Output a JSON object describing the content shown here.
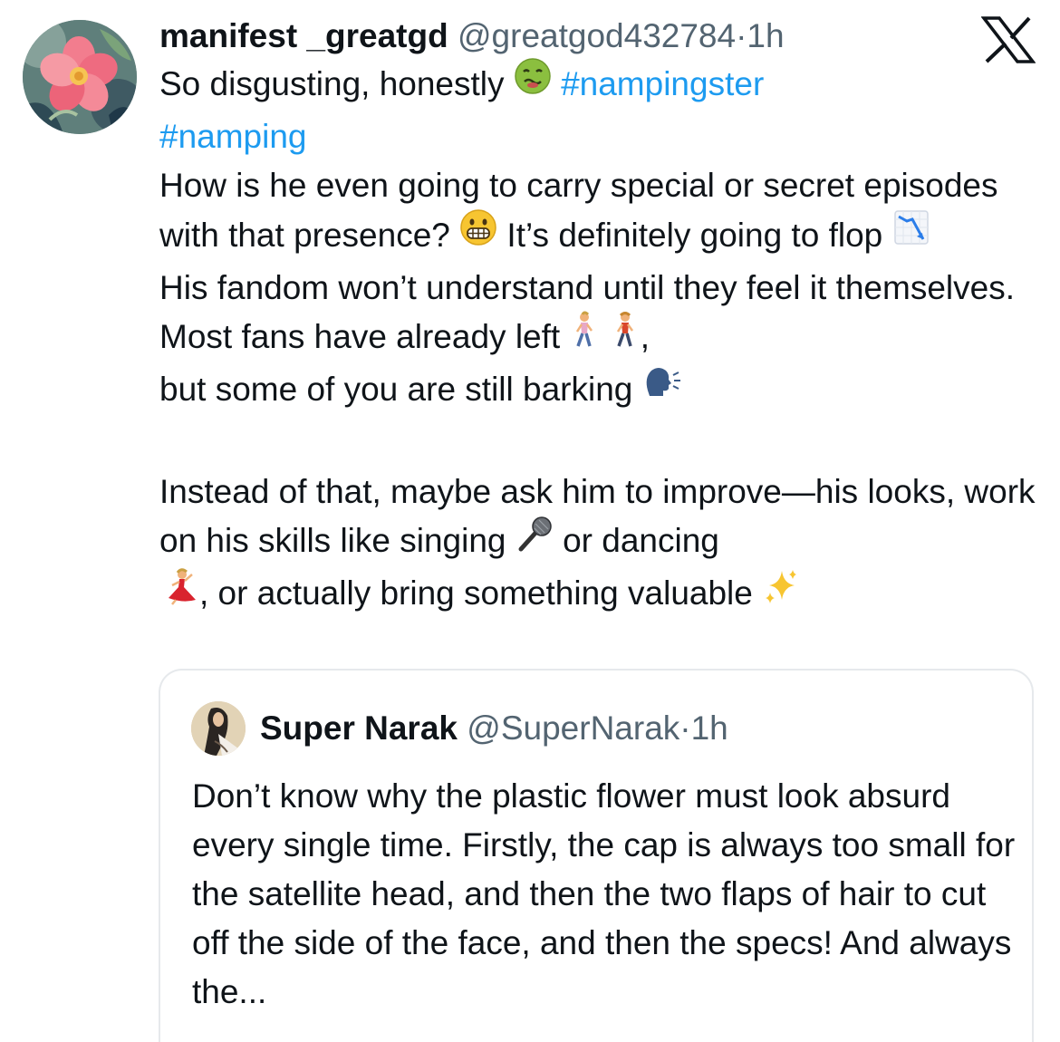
{
  "post": {
    "author_name": "manifest _greatgd",
    "author_handle": "@greatgod432784",
    "dot": "·",
    "time": "1h",
    "line1_text": "So disgusting, honestly",
    "hashtag1": "#nampingster",
    "hashtag2": "#namping",
    "p1": "How is he even going to carry special or secret episodes with that presence?",
    "p2": "It’s definitely going to flop",
    "p3": "His fandom won’t understand until they feel it themselves. Most fans have already left",
    "p3_comma": ",",
    "p4": "but some of you are still barking",
    "p5": "Instead of that, maybe ask him to improve—his looks, work on his skills like singing",
    "p6": "or dancing",
    "p7": ", or actually bring something valuable"
  },
  "quote": {
    "author_name": "Super Narak",
    "author_handle": "@SuperNarak",
    "dot": "·",
    "time": "1h",
    "text": "Don’t know why the plastic flower must look absurd every single time. Firstly, the cap is always too small for the satellite head, and then the two flaps of hair to cut off the side of the face, and then the specs! And always the..."
  },
  "icons": {
    "logo": "x-logo-icon",
    "nauseated": "nauseated-face-icon",
    "grimace": "grimacing-face-icon",
    "chart_down": "chart-decreasing-icon",
    "walking": "person-walking-icon",
    "speaking": "speaking-head-icon",
    "mic": "microphone-icon",
    "dancer": "dancer-icon",
    "sparkles": "sparkles-icon"
  },
  "colors": {
    "link": "#1d9bf0",
    "secondary_text": "#536471",
    "primary_text": "#0f1419",
    "card_border": "#e6e9ec"
  }
}
